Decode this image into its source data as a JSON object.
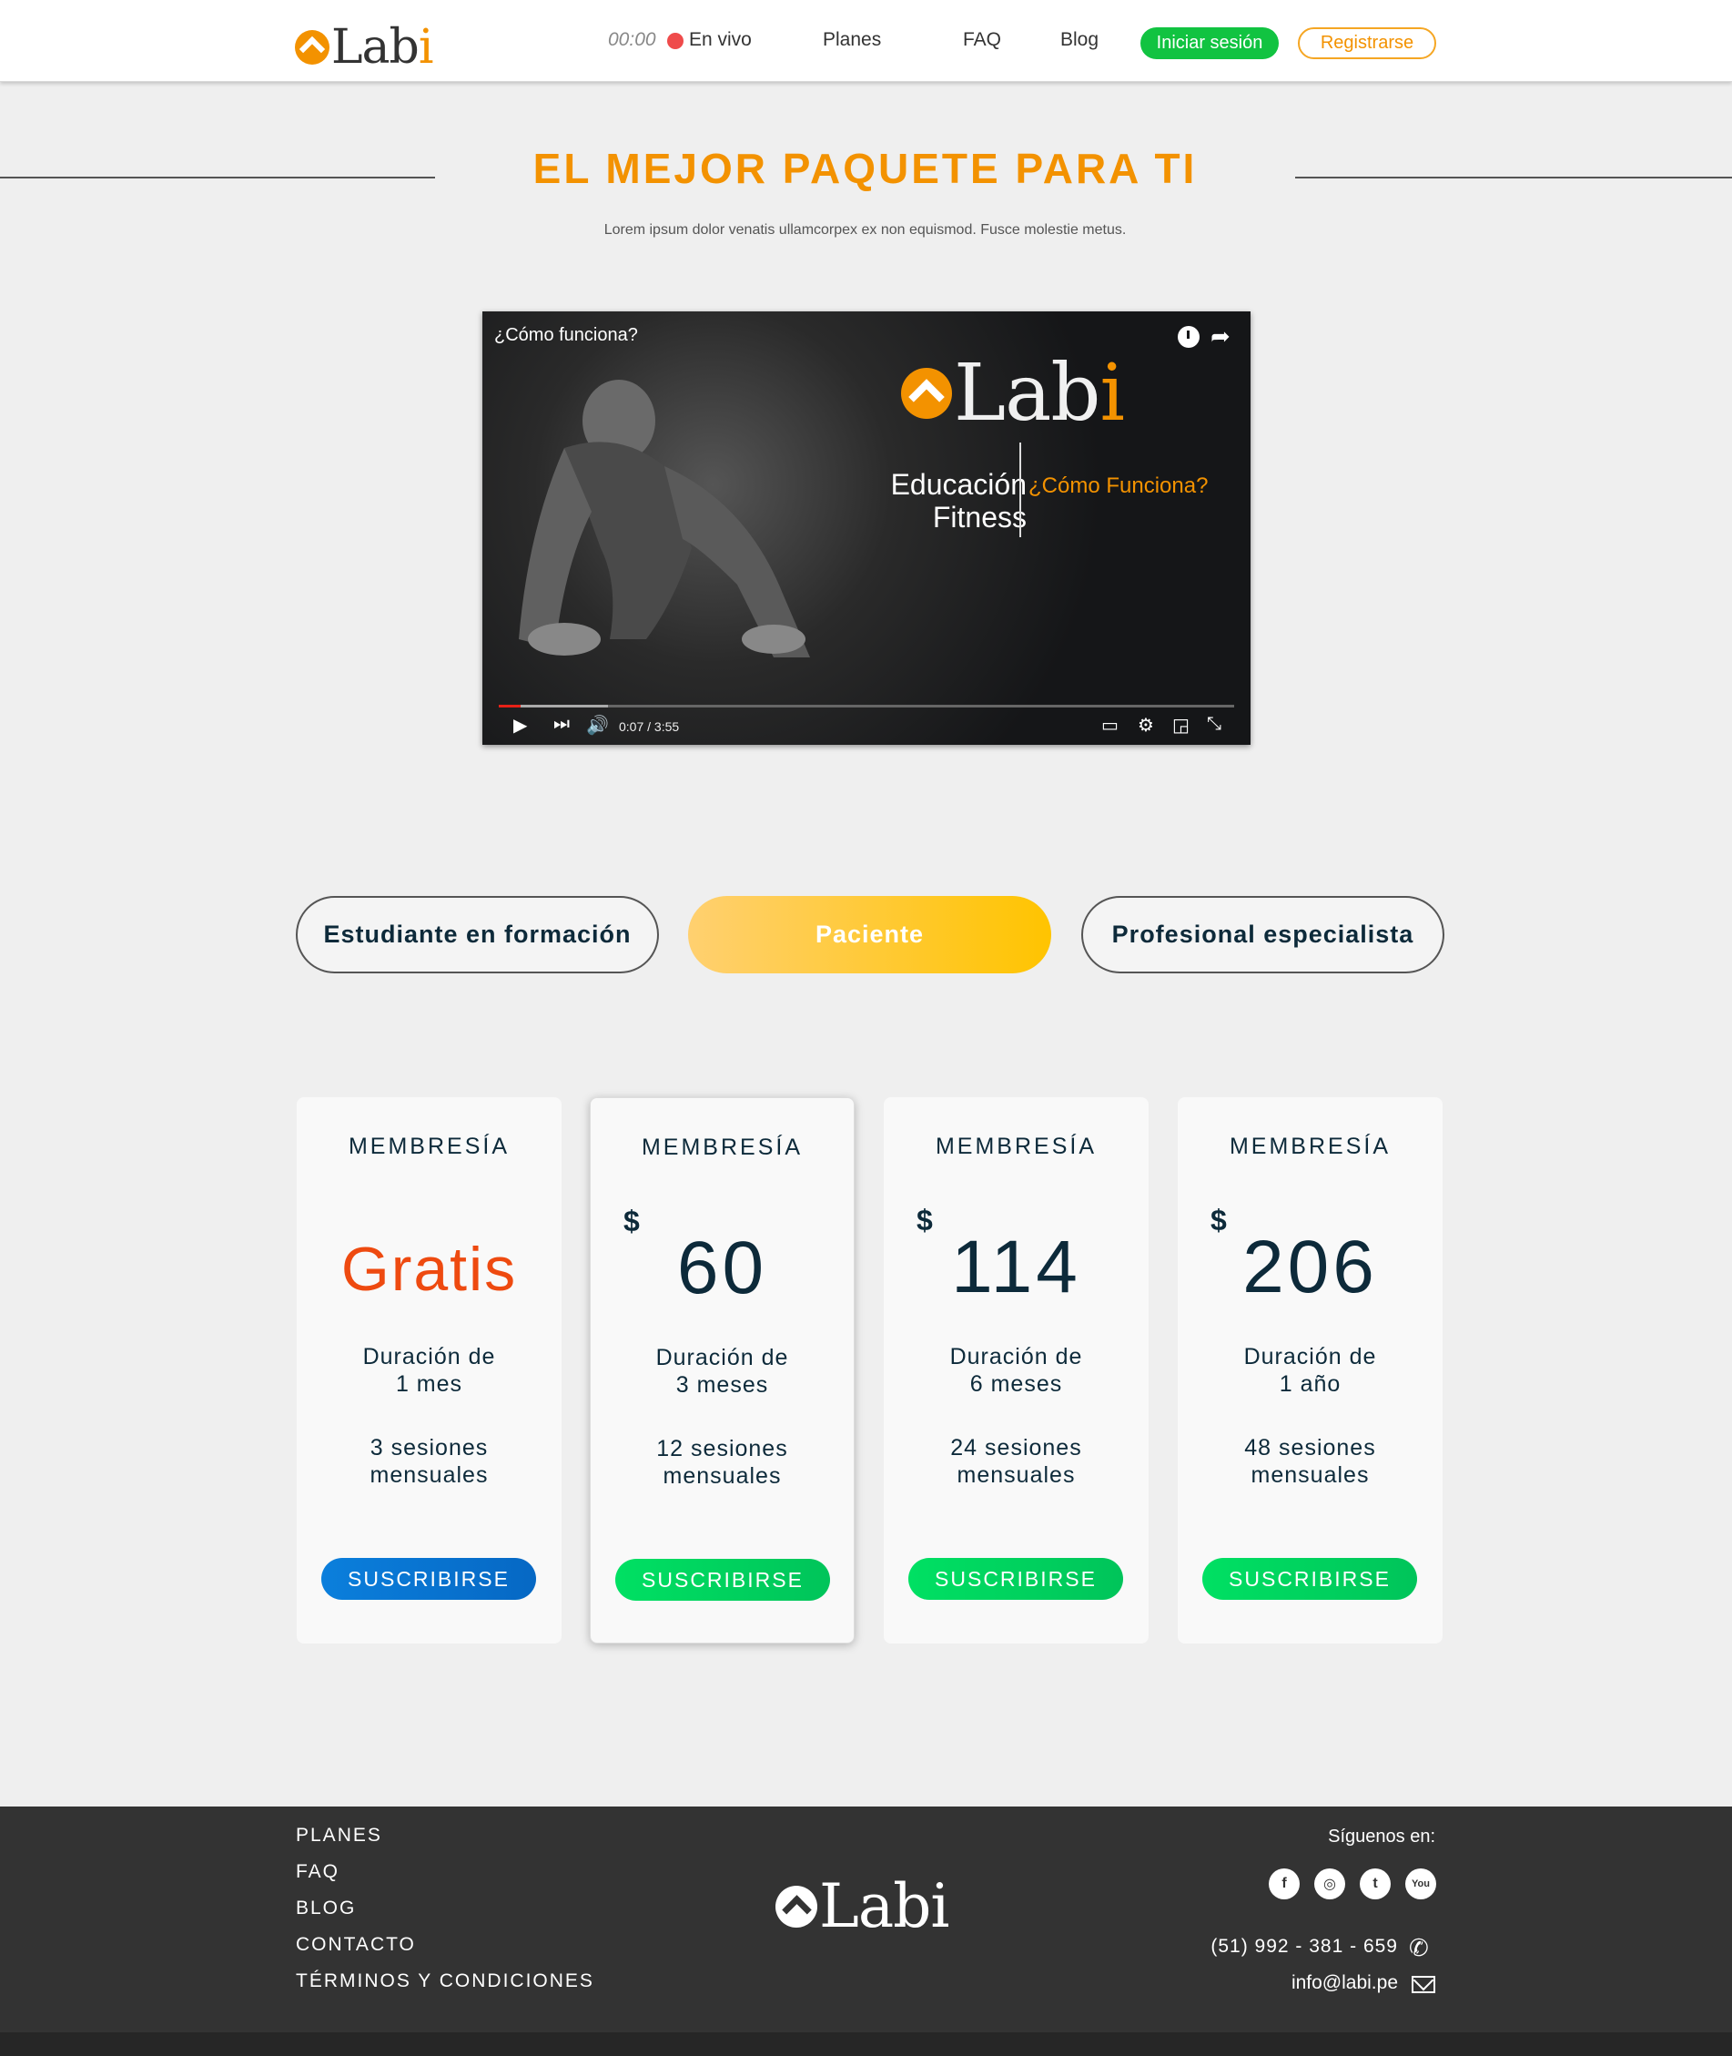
{
  "header": {
    "logo": {
      "text_main": "Lab",
      "text_accent": "i"
    },
    "clock": "00:00",
    "live_label": "En vivo",
    "nav": {
      "planes": "Planes",
      "faq": "FAQ",
      "blog": "Blog"
    },
    "login_label": "Iniciar sesión",
    "register_label": "Registrarse"
  },
  "hero": {
    "title": "EL MEJOR PAQUETE PARA TI",
    "subtitle": "Lorem ipsum dolor venatis ullamcorpex ex non equismod. Fusce molestie metus."
  },
  "video": {
    "title": "¿Cómo funciona?",
    "logo_main": "Lab",
    "logo_accent": "i",
    "line1": "Educación",
    "line2": "Fitness",
    "how": "¿Cómo Funciona?",
    "time": "0:07 / 3:55",
    "progress_fraction": 0.03,
    "icons": [
      "clock-icon",
      "share-icon",
      "play-icon",
      "next-icon",
      "volume-icon",
      "subtitles-icon",
      "settings-icon",
      "cast-icon",
      "exit-fullscreen-icon"
    ]
  },
  "tabs": [
    {
      "label": "Estudiante en formación",
      "active": false
    },
    {
      "label": "Paciente",
      "active": true
    },
    {
      "label": "Profesional especialista",
      "active": false
    }
  ],
  "plans": [
    {
      "title": "MEMBRESÍA",
      "currency": "",
      "price": "Gratis",
      "duration_label": "Duración de",
      "duration": "1 mes",
      "sessions": "3 sesiones",
      "sessions_label": "mensuales",
      "button": "SUSCRIBIRSE"
    },
    {
      "title": "MEMBRESÍA",
      "currency": "$",
      "price": "60",
      "duration_label": "Duración de",
      "duration": "3 meses",
      "sessions": "12 sesiones",
      "sessions_label": "mensuales",
      "button": "SUSCRIBIRSE"
    },
    {
      "title": "MEMBRESÍA",
      "currency": "$",
      "price": "114",
      "duration_label": "Duración de",
      "duration": "6 meses",
      "sessions": "24 sesiones",
      "sessions_label": "mensuales",
      "button": "SUSCRIBIRSE"
    },
    {
      "title": "MEMBRESÍA",
      "currency": "$",
      "price": "206",
      "duration_label": "Duración de",
      "duration": "1 año",
      "sessions": "48 sesiones",
      "sessions_label": "mensuales",
      "button": "SUSCRIBIRSE"
    }
  ],
  "footer": {
    "links": [
      "PLANES",
      "FAQ",
      "BLOG",
      "CONTACTO",
      "TÉRMINOS Y CONDICIONES"
    ],
    "logo_text": "Labi",
    "follow": "Síguenos en:",
    "social": [
      "f",
      "◎",
      "t",
      "You"
    ],
    "phone": "(51) 992 - 381 - 659",
    "email": "info@labi.pe"
  },
  "colors": {
    "accent": "#f39200",
    "live": "#ef4b4b",
    "login_bg": "#11c341",
    "free_price": "#ee4a10",
    "subscribe_green": "#00d15f",
    "subscribe_blue": "#0b7fdc",
    "footer_bg": "#333333"
  }
}
